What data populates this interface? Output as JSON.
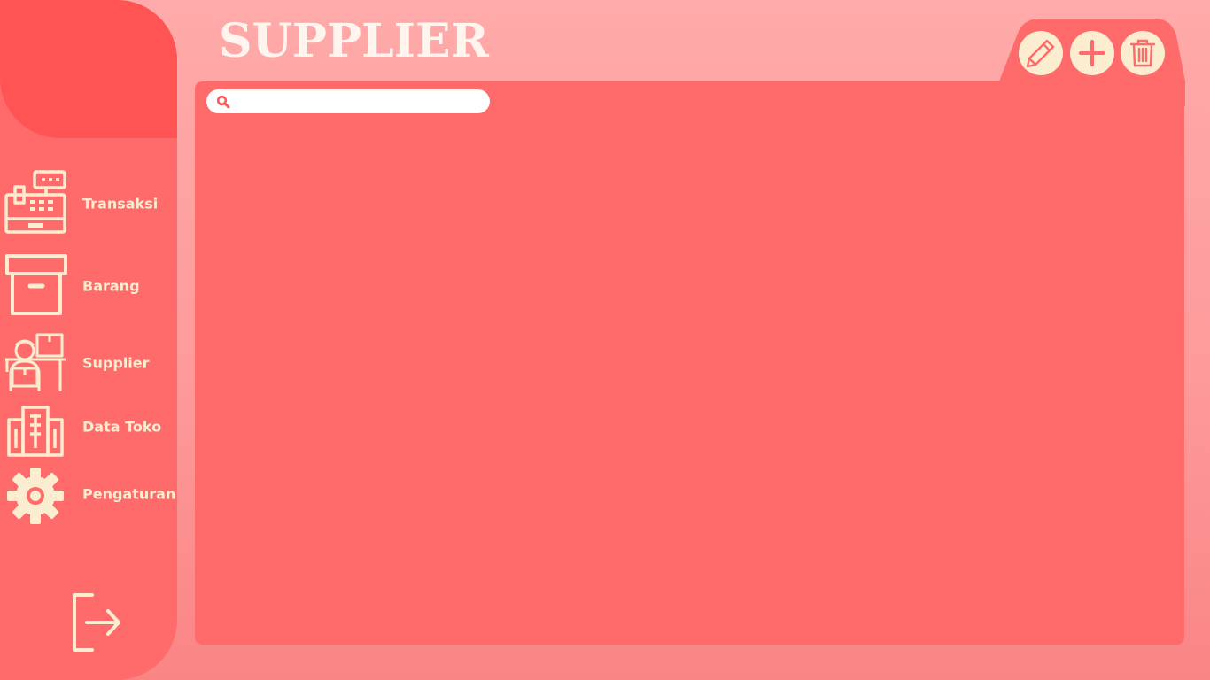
{
  "page": {
    "title": "SUPPLIER"
  },
  "sidebar": {
    "items": [
      {
        "label": "Transaksi",
        "icon": "cash-register-icon"
      },
      {
        "label": "Barang",
        "icon": "box-icon"
      },
      {
        "label": "Supplier",
        "icon": "supplier-icon"
      },
      {
        "label": "Data Toko",
        "icon": "building-icon"
      },
      {
        "label": "Pengaturan",
        "icon": "gear-icon"
      }
    ],
    "logout": {
      "icon": "logout-icon"
    }
  },
  "toolbar": {
    "buttons": [
      {
        "icon": "pencil-icon"
      },
      {
        "icon": "plus-icon"
      },
      {
        "icon": "trash-icon"
      }
    ]
  },
  "search": {
    "value": "",
    "placeholder": "",
    "icon": "search-icon"
  },
  "colors": {
    "background": "#ffaaaa",
    "sidebar": "#ff6b6b",
    "logo_block": "#ff5354",
    "panel": "#ff6b6b",
    "accent_cream": "#fcecd0",
    "search_icon": "#ff5a5a"
  }
}
